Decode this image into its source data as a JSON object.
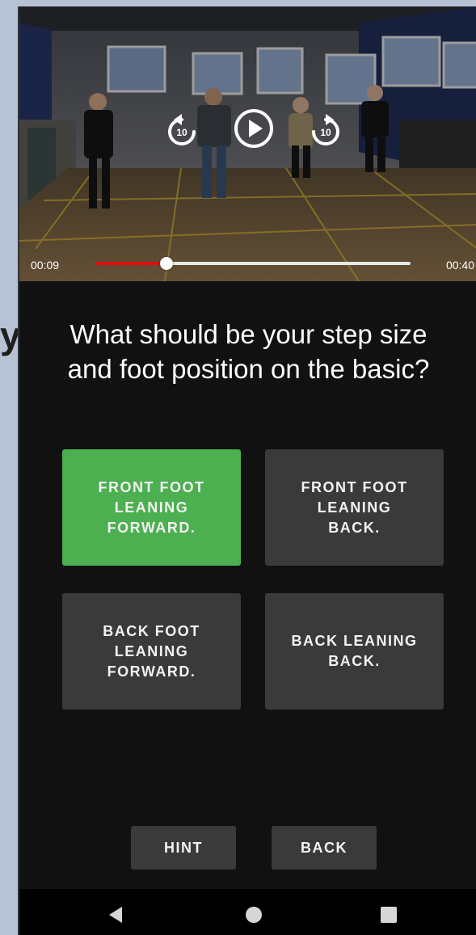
{
  "video": {
    "elapsed": "00:09",
    "total": "00:40",
    "progress": 0.225,
    "rewind_seconds": "10",
    "forward_seconds": "10",
    "colors": {
      "played": "#e20c0c",
      "track": "#e7e7e7"
    },
    "icons": {
      "rewind": "replay-10-icon",
      "play": "play-circle-icon",
      "forward": "forward-10-icon"
    }
  },
  "left_artifact": {
    "text": "y"
  },
  "question": {
    "line1": "What should be your step size",
    "line2": "and foot position on the basic?"
  },
  "answers": [
    {
      "lines": [
        "FRONT FOOT",
        "LEANING",
        "FORWARD."
      ],
      "selected": true
    },
    {
      "lines": [
        "FRONT FOOT",
        "LEANING",
        "BACK."
      ],
      "selected": false
    },
    {
      "lines": [
        "BACK FOOT",
        "LEANING",
        "FORWARD."
      ],
      "selected": false
    },
    {
      "lines": [
        "BACK LEANING",
        "BACK."
      ],
      "selected": false
    }
  ],
  "actions": {
    "hint_label": "HINT",
    "back_label": "BACK"
  },
  "nav": {
    "icons": [
      "nav-back-icon",
      "nav-home-icon",
      "nav-recents-icon"
    ]
  },
  "colors": {
    "selected_answer": "#4caf50",
    "answer_bg": "#3a3a3a",
    "screen_bg": "#111111"
  }
}
